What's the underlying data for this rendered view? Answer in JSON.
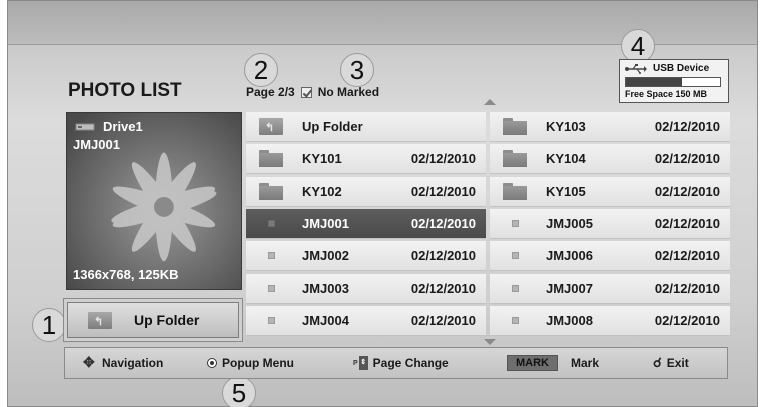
{
  "header": {
    "title": "PHOTO LIST",
    "page_info": "Page 2/3",
    "marked_status": "No Marked"
  },
  "callouts": [
    "1",
    "2",
    "3",
    "4",
    "5"
  ],
  "usb": {
    "label": "USB Device",
    "free_space": "Free Space 150 MB",
    "used_fraction": 0.6,
    "icon": "usb-icon"
  },
  "preview": {
    "drive": "Drive1",
    "file": "JMJ001",
    "resolution_size": "1366x768, 125KB",
    "icon": "drive-icon"
  },
  "up_folder_button": {
    "label": "Up Folder",
    "icon": "up-folder-icon"
  },
  "grid": {
    "left": [
      {
        "type": "upfolder",
        "name": "Up Folder",
        "date": ""
      },
      {
        "type": "folder",
        "name": "KY101",
        "date": "02/12/2010"
      },
      {
        "type": "folder",
        "name": "KY102",
        "date": "02/12/2010"
      },
      {
        "type": "photo",
        "name": "JMJ001",
        "date": "02/12/2010",
        "selected": true
      },
      {
        "type": "photo",
        "name": "JMJ002",
        "date": "02/12/2010"
      },
      {
        "type": "photo",
        "name": "JMJ003",
        "date": "02/12/2010"
      },
      {
        "type": "photo",
        "name": "JMJ004",
        "date": "02/12/2010"
      }
    ],
    "right": [
      {
        "type": "folder",
        "name": "KY103",
        "date": "02/12/2010"
      },
      {
        "type": "folder",
        "name": "KY104",
        "date": "02/12/2010"
      },
      {
        "type": "folder",
        "name": "KY105",
        "date": "02/12/2010"
      },
      {
        "type": "photo",
        "name": "JMJ005",
        "date": "02/12/2010"
      },
      {
        "type": "photo",
        "name": "JMJ006",
        "date": "02/12/2010"
      },
      {
        "type": "photo",
        "name": "JMJ007",
        "date": "02/12/2010"
      },
      {
        "type": "photo",
        "name": "JMJ008",
        "date": "02/12/2010"
      }
    ]
  },
  "footer": {
    "navigation": "Navigation",
    "popup_menu": "Popup Menu",
    "page_change": "Page Change",
    "mark_key": "MARK",
    "mark": "Mark",
    "exit": "Exit"
  },
  "colors": {
    "selected_row": "#4a4a4a",
    "row_bg": "#e8e8e8",
    "panel_bg": "#d0d0d0"
  }
}
